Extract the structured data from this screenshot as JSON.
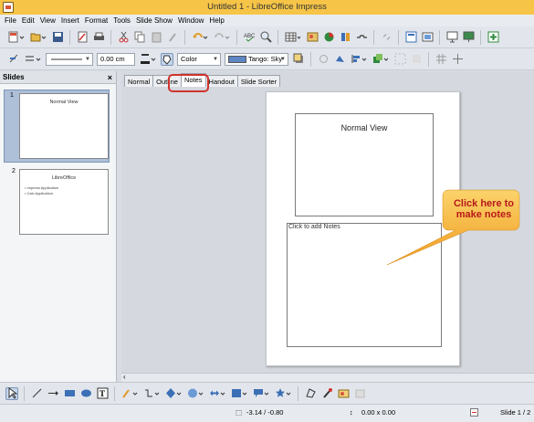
{
  "window": {
    "title": "Untitled 1 - LibreOffice Impress"
  },
  "menu": [
    "File",
    "Edit",
    "View",
    "Insert",
    "Format",
    "Tools",
    "Slide Show",
    "Window",
    "Help"
  ],
  "toolbar2": {
    "line_width": "0.00 cm",
    "area_style": "Color",
    "area_color": "Tango: Sky",
    "area_color_hex": "#5e86c2"
  },
  "slides_pane": {
    "title": "Slides",
    "slides": [
      {
        "number": "1",
        "title": "Normal View",
        "bullets": []
      },
      {
        "number": "2",
        "title": "LibreOffice",
        "bullets": [
          "• Impress Application",
          "• Calc Application"
        ]
      }
    ]
  },
  "view_tabs": [
    "Normal",
    "Outline",
    "Notes",
    "Handout",
    "Slide Sorter"
  ],
  "active_tab": "Notes",
  "notes_page": {
    "slide_title": "Normal View",
    "notes_placeholder": "Click to add Notes"
  },
  "callout": {
    "line1": "Click here to",
    "line2": "make notes",
    "color": "#f4a531",
    "text_color": "#b8191a"
  },
  "status": {
    "position": "-3.14 / -0.80",
    "size": "0.00 x 0.00",
    "slide": "Slide 1 / 2"
  },
  "colors": {
    "titlebar": "#f6c548",
    "highlight": "#d0332d"
  }
}
